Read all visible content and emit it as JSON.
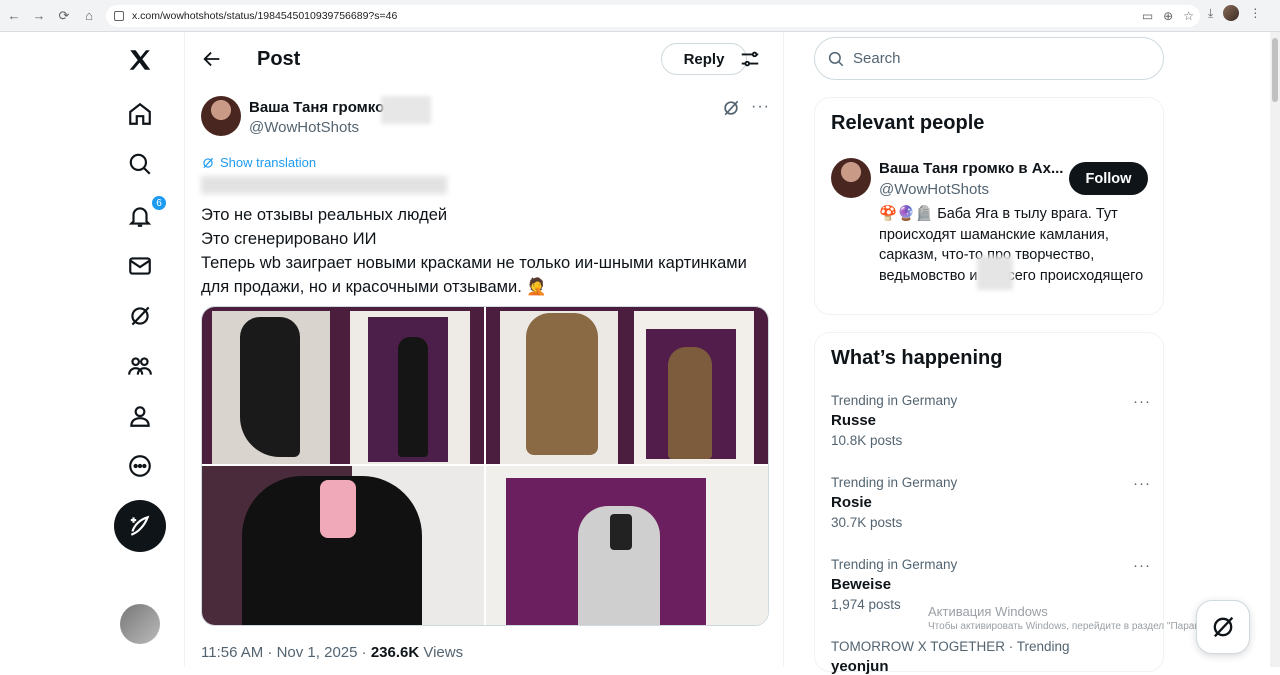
{
  "browser": {
    "url": "x.com/wowhotshots/status/1984545010939756689?s=46"
  },
  "header": {
    "title": "Post",
    "reply_label": "Reply"
  },
  "nav": {
    "notifications_badge": "6"
  },
  "post": {
    "author_name": "Ваша Таня громко",
    "author_handle": "@WowHotShots",
    "translate_label": "Show translation",
    "lines": [
      "Это не отзывы реальных людей",
      "Это сгенерировано ИИ",
      "Теперь wb заиграет новыми красками не только ии-шными картинками для продажи, но и красочными отзывами. 🤦"
    ],
    "time": "11:56 AM · Nov 1, 2025 · ",
    "views_count": "236.6K",
    "views_label": " Views"
  },
  "search": {
    "placeholder": "Search"
  },
  "relevant": {
    "heading": "Relevant people",
    "name": "Ваша Таня громко в Ах...",
    "handle": "@WowHotShots",
    "follow_label": "Follow",
    "bio": "🍄🔮🪦 Баба Яга в тылу врага. Тут происходят шаманские камлания, сарказм, что-то про творчество, ведьмовство и       от всего происходящего"
  },
  "happening": {
    "heading": "What’s happening",
    "trends": [
      {
        "context": "Trending in Germany",
        "title": "Russe",
        "posts": "10.8K posts"
      },
      {
        "context": "Trending in Germany",
        "title": "Rosie",
        "posts": "30.7K posts"
      },
      {
        "context": "Trending in Germany",
        "title": "Beweise",
        "posts": "1,974 posts"
      },
      {
        "context": "TOMORROW X TOGETHER · Trending",
        "title": "yeonjun",
        "posts": ""
      }
    ]
  },
  "watermark": {
    "line1": "Активация Windows",
    "line2": "Чтобы активировать Windows, перейдите в раздел \"Парамет"
  }
}
